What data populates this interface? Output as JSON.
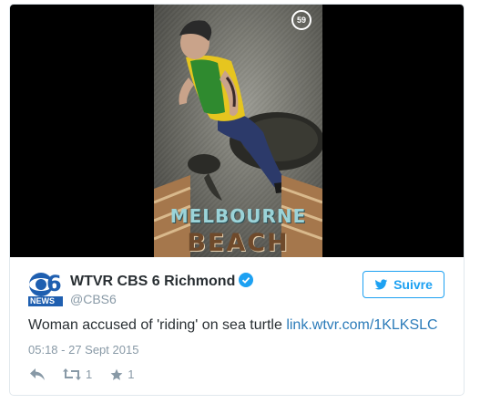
{
  "media": {
    "counter": "59",
    "geofilter_line1": "MELBOURNE",
    "geofilter_line2": "BEACH"
  },
  "author": {
    "logo_text": "6",
    "logo_badge": "NEWS",
    "display_name": "WTVR CBS 6 Richmond",
    "handle": "@CBS6",
    "verified": true
  },
  "follow_button": {
    "label": "Suivre",
    "icon": "twitter-bird-icon"
  },
  "tweet": {
    "text": "Woman accused of 'riding' on sea turtle",
    "link": "link.wtvr.com/1KLKSLC",
    "timestamp": "05:18 - 27 Sept 2015"
  },
  "actions": {
    "reply": {
      "icon": "reply-icon"
    },
    "retweet": {
      "icon": "retweet-icon",
      "count": "1"
    },
    "favorite": {
      "icon": "star-icon",
      "count": "1"
    }
  },
  "colors": {
    "accent": "#1da1f2",
    "text": "#292f33",
    "muted": "#8899a6",
    "link": "#2b7bb9"
  }
}
